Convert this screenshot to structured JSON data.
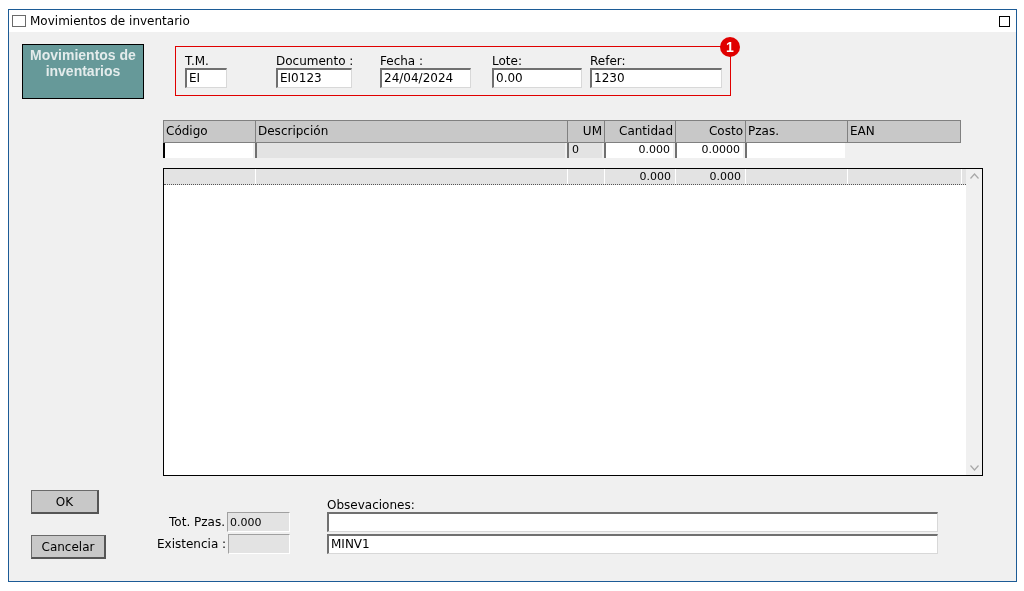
{
  "window": {
    "title": "Movimientos de inventario"
  },
  "logo": {
    "text": "Movimientos de inventarios"
  },
  "header": {
    "badge": "1",
    "fields": [
      {
        "label": "T.M.",
        "value": "EI"
      },
      {
        "label": "Documento :",
        "value": "EI0123"
      },
      {
        "label": "Fecha :",
        "value": "24/04/2024"
      },
      {
        "label": "Lote:",
        "value": "0.00"
      },
      {
        "label": "Refer:",
        "value": "1230"
      }
    ]
  },
  "grid": {
    "columns": [
      {
        "label": "Código",
        "entry": {
          "kind": "input",
          "focused": true
        }
      },
      {
        "label": "Descripción",
        "entry": {
          "kind": "readonly"
        }
      },
      {
        "label": "UM",
        "entry": {
          "kind": "readonly",
          "value": "0"
        }
      },
      {
        "label": "Cantidad",
        "entry": {
          "kind": "input",
          "value": "0.000"
        },
        "total": "0.000"
      },
      {
        "label": "Costo",
        "entry": {
          "kind": "input",
          "value": "0.0000"
        },
        "total": "0.000"
      },
      {
        "label": "Pzas.",
        "entry": {
          "kind": "input"
        }
      },
      {
        "label": "EAN"
      }
    ]
  },
  "footer": {
    "buttons": [
      "OK",
      "Cancelar"
    ],
    "totals": [
      {
        "label": "Tot. Pzas.",
        "value": "0.000"
      },
      {
        "label": "Existencia :"
      }
    ],
    "notes": {
      "label": "Obsevaciones:",
      "lines": [
        {
          "kind": "empty"
        },
        {
          "kind": "text",
          "value": "MINV1"
        }
      ]
    }
  }
}
